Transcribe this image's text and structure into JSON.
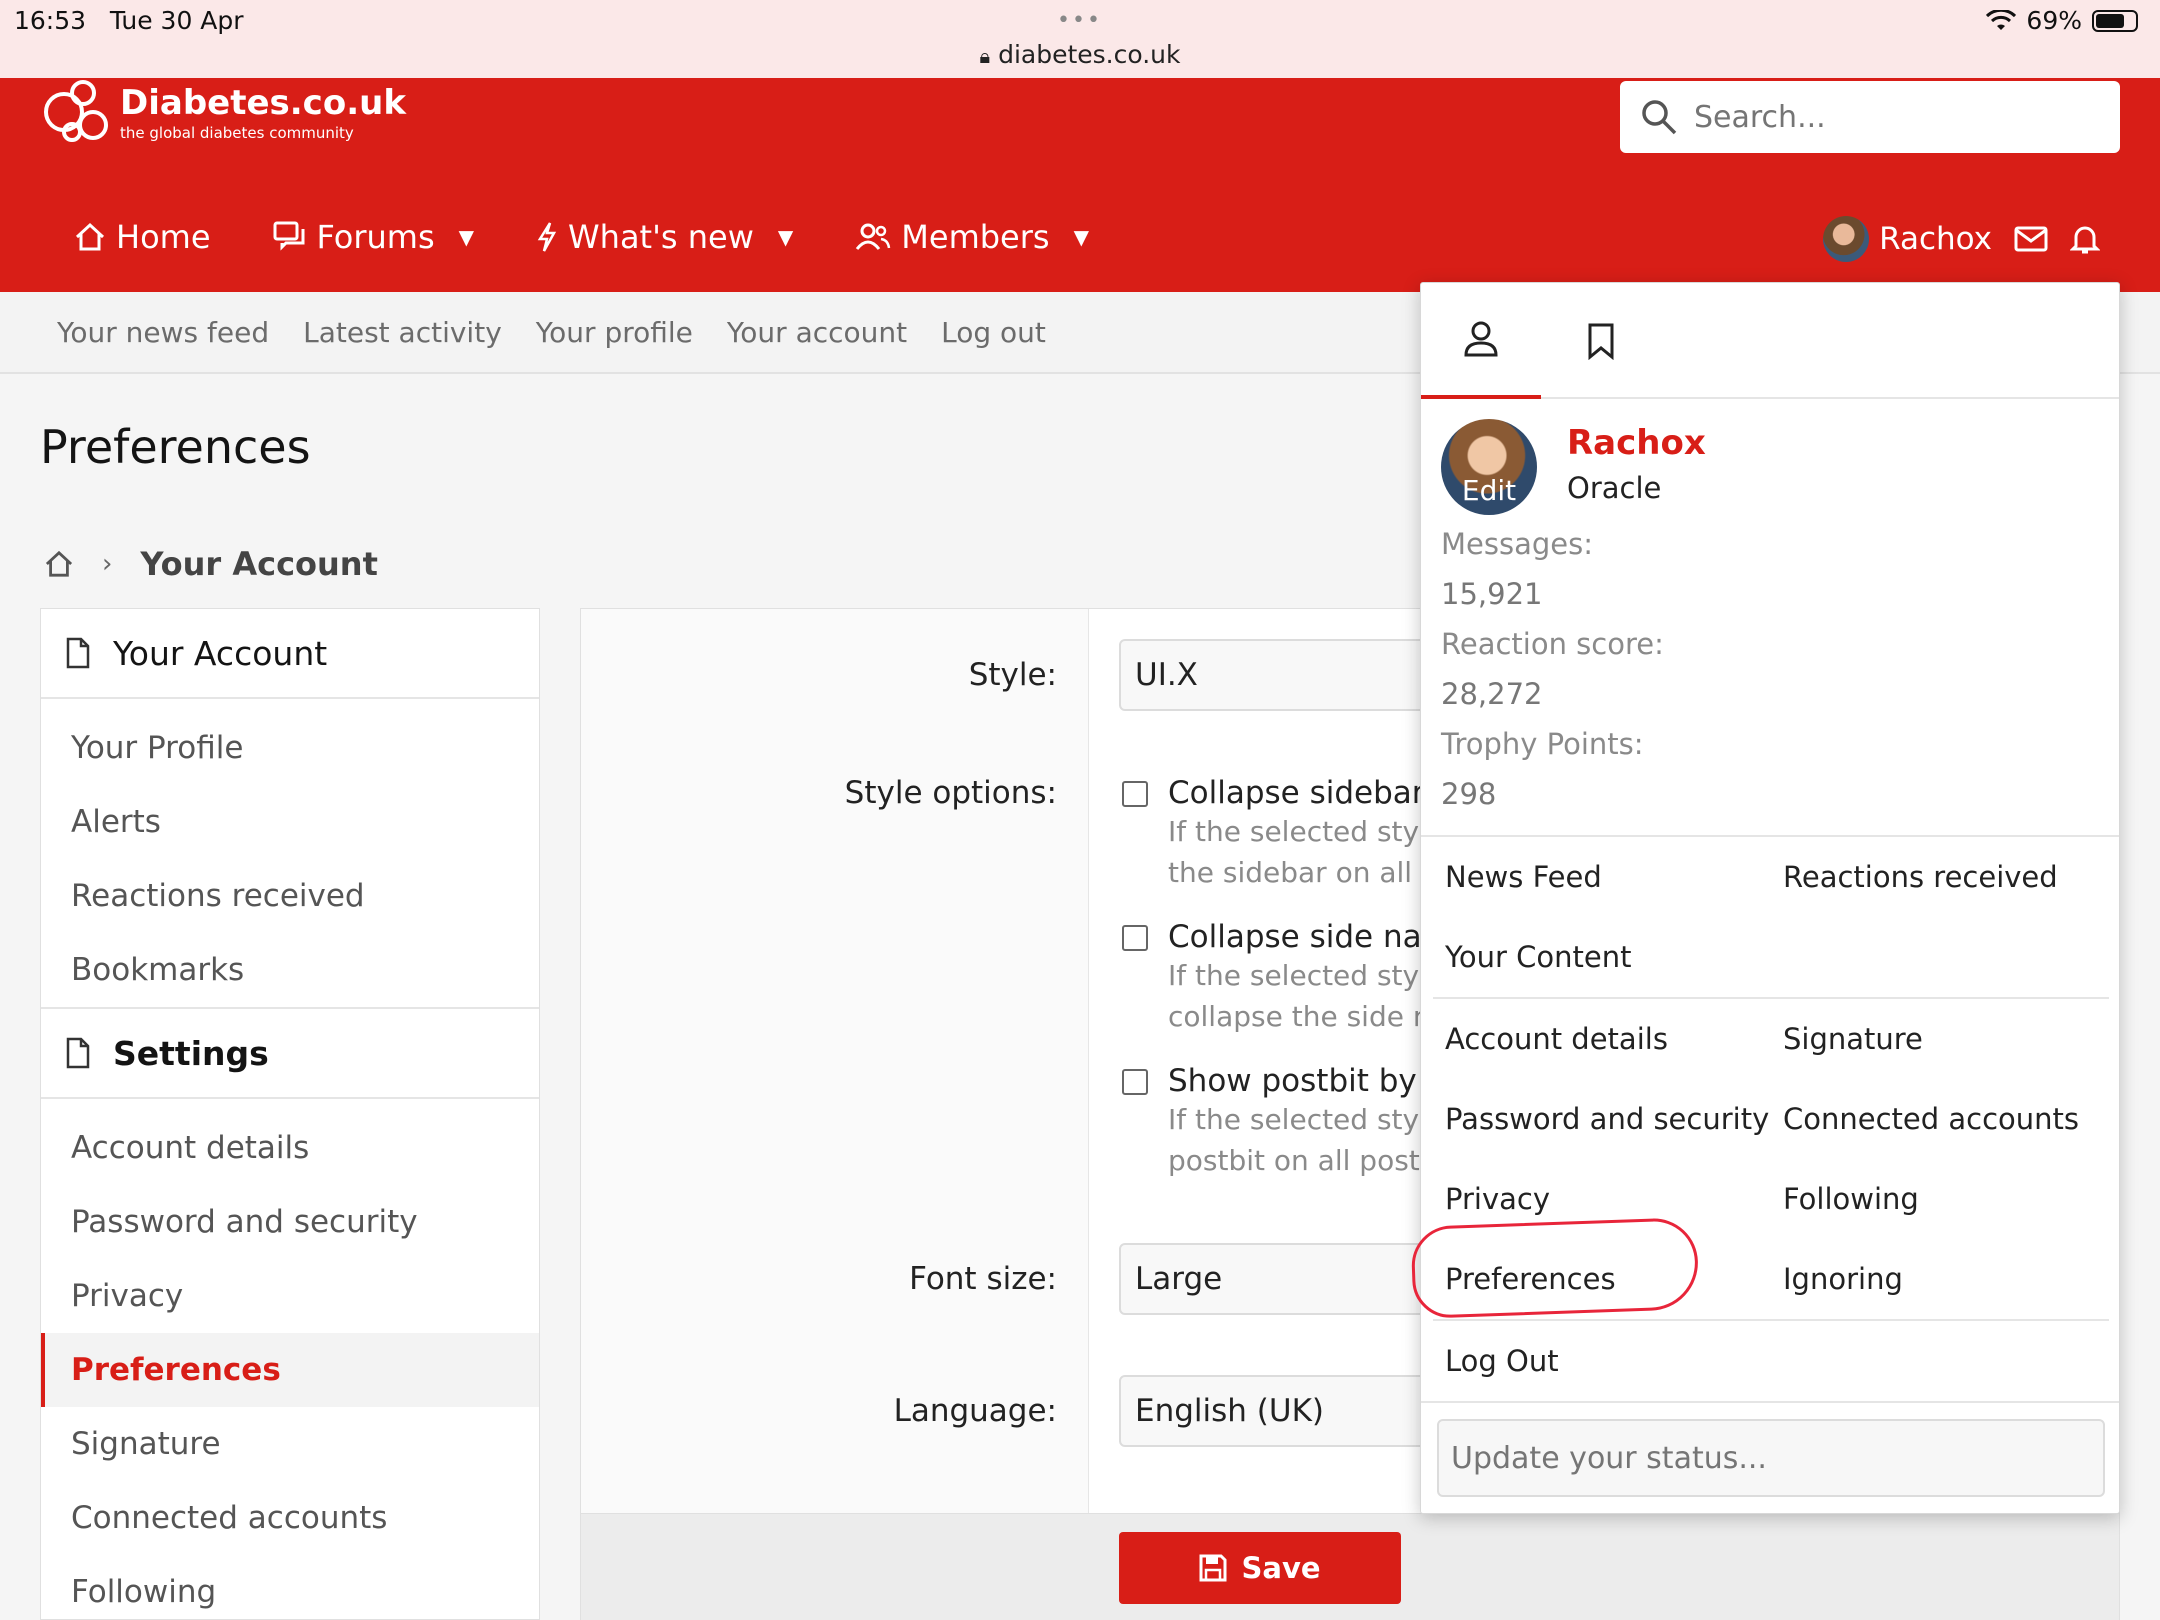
{
  "status_bar": {
    "time": "16:53",
    "date": "Tue 30 Apr",
    "url": "diabetes.co.uk",
    "battery": "69%"
  },
  "header": {
    "logo_title": "Diabetes.co.uk",
    "logo_subtitle": "the global diabetes community",
    "search_placeholder": "Search...",
    "nav": [
      {
        "label": "Home",
        "icon": "home-icon"
      },
      {
        "label": "Forums",
        "icon": "forums-icon"
      },
      {
        "label": "What's new",
        "icon": "bolt-icon"
      },
      {
        "label": "Members",
        "icon": "members-icon"
      }
    ],
    "username": "Rachox",
    "brand_color": "#d81e17"
  },
  "subnav": [
    "Your news feed",
    "Latest activity",
    "Your profile",
    "Your account",
    "Log out"
  ],
  "page": {
    "title": "Preferences",
    "breadcrumb": "Your Account"
  },
  "sidebar": {
    "account_heading": "Your Account",
    "account_items": [
      "Your Profile",
      "Alerts",
      "Reactions received",
      "Bookmarks"
    ],
    "settings_heading": "Settings",
    "settings_items": [
      "Account details",
      "Password and security",
      "Privacy",
      "Preferences",
      "Signature",
      "Connected accounts",
      "Following"
    ],
    "active_item": "Preferences"
  },
  "form": {
    "style_label": "Style:",
    "style_value": "UI.X",
    "style_options_label": "Style options:",
    "options": [
      {
        "title": "Collapse sidebar b",
        "hint1": "If the selected style",
        "hint2": "the sidebar on all p"
      },
      {
        "title": "Collapse side nav",
        "hint1": "If the selected style",
        "hint2": "collapse the side n"
      },
      {
        "title": "Show postbit by d",
        "hint1": "If the selected style",
        "hint2": "postbit on all posts"
      }
    ],
    "font_size_label": "Font size:",
    "font_size_value": "Large",
    "language_label": "Language:",
    "language_value": "English (UK)",
    "save_label": "Save"
  },
  "menu": {
    "avatar_edit": "Edit",
    "name": "Rachox",
    "title": "Oracle",
    "messages_label": "Messages:",
    "messages_value": "15,921",
    "reaction_label": "Reaction score:",
    "reaction_value": "28,272",
    "trophy_label": "Trophy Points:",
    "trophy_value": "298",
    "group1": [
      [
        "News Feed",
        "Reactions received"
      ],
      [
        "Your Content",
        ""
      ]
    ],
    "group2": [
      [
        "Account details",
        "Signature"
      ],
      [
        "Password and security",
        "Connected accounts"
      ],
      [
        "Privacy",
        "Following"
      ],
      [
        "Preferences",
        "Ignoring"
      ]
    ],
    "logout": "Log Out",
    "status_placeholder": "Update your status..."
  }
}
